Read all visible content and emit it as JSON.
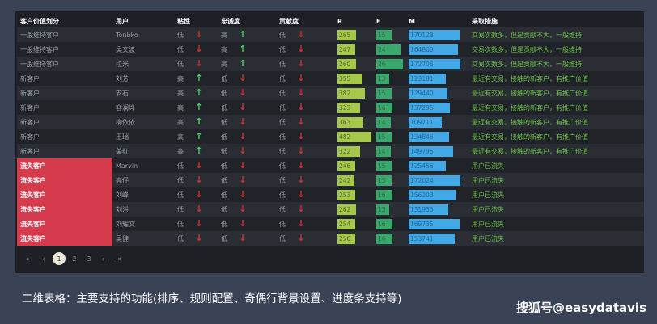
{
  "table": {
    "columns": [
      "客户价值划分",
      "用户",
      "粘性",
      "忠诚度",
      "贡献度",
      "R",
      "F",
      "M",
      "采取措施"
    ],
    "rows": [
      {
        "segment": "一般维持客户",
        "user": "Tonbko",
        "stick": "低",
        "stick_dir": "down",
        "loyal": "高",
        "loyal_dir": "up",
        "contrib": "低",
        "contrib_dir": "down",
        "r": 265,
        "f": 15,
        "m": 170128,
        "action": "交易次数多，但是贡献不大，一般维持"
      },
      {
        "segment": "一般维持客户",
        "user": "吴文波",
        "stick": "低",
        "stick_dir": "down",
        "loyal": "高",
        "loyal_dir": "up",
        "contrib": "低",
        "contrib_dir": "down",
        "r": 247,
        "f": 24,
        "m": 164800,
        "action": "交易次数多，但是贡献不大，一般维持"
      },
      {
        "segment": "一般维持客户",
        "user": "拉米",
        "stick": "低",
        "stick_dir": "down",
        "loyal": "高",
        "loyal_dir": "up",
        "contrib": "低",
        "contrib_dir": "down",
        "r": 260,
        "f": 26,
        "m": 172706,
        "action": "交易次数多，但是贡献不大，一般维持"
      },
      {
        "segment": "新客户",
        "user": "刘芳",
        "stick": "高",
        "stick_dir": "up",
        "loyal": "低",
        "loyal_dir": "down",
        "contrib": "低",
        "contrib_dir": "down",
        "r": 355,
        "f": 13,
        "m": 123181,
        "action": "最近有交易，接触的新客户，有推广价值"
      },
      {
        "segment": "新客户",
        "user": "安石",
        "stick": "高",
        "stick_dir": "up",
        "loyal": "低",
        "loyal_dir": "down",
        "contrib": "低",
        "contrib_dir": "down",
        "r": 382,
        "f": 15,
        "m": 129440,
        "action": "最近有交易，接触的新客户，有推广价值"
      },
      {
        "segment": "新客户",
        "user": "容澜烨",
        "stick": "高",
        "stick_dir": "up",
        "loyal": "低",
        "loyal_dir": "down",
        "contrib": "低",
        "contrib_dir": "down",
        "r": 323,
        "f": 16,
        "m": 137295,
        "action": "最近有交易，接触的新客户，有推广价值"
      },
      {
        "segment": "新客户",
        "user": "柳依依",
        "stick": "高",
        "stick_dir": "up",
        "loyal": "低",
        "loyal_dir": "down",
        "contrib": "低",
        "contrib_dir": "down",
        "r": 363,
        "f": 14,
        "m": 109711,
        "action": "最近有交易，接触的新客户，有推广价值"
      },
      {
        "segment": "新客户",
        "user": "王瑞",
        "stick": "高",
        "stick_dir": "up",
        "loyal": "低",
        "loyal_dir": "down",
        "contrib": "低",
        "contrib_dir": "down",
        "r": 482,
        "f": 15,
        "m": 134846,
        "action": "最近有交易，接触的新客户，有推广价值"
      },
      {
        "segment": "新客户",
        "user": "美红",
        "stick": "高",
        "stick_dir": "up",
        "loyal": "低",
        "loyal_dir": "down",
        "contrib": "低",
        "contrib_dir": "down",
        "r": 322,
        "f": 14,
        "m": 149795,
        "action": "最近有交易，接触的新客户，有推广价值"
      },
      {
        "segment": "流失客户",
        "user": "Marvin",
        "stick": "低",
        "stick_dir": "down",
        "loyal": "低",
        "loyal_dir": "down",
        "contrib": "低",
        "contrib_dir": "down",
        "r": 246,
        "f": 15,
        "m": 125456,
        "action": "用户已流失"
      },
      {
        "segment": "流失客户",
        "user": "亮仔",
        "stick": "低",
        "stick_dir": "down",
        "loyal": "低",
        "loyal_dir": "down",
        "contrib": "低",
        "contrib_dir": "down",
        "r": 242,
        "f": 15,
        "m": 172024,
        "action": "用户已流失"
      },
      {
        "segment": "流失客户",
        "user": "刘峰",
        "stick": "低",
        "stick_dir": "down",
        "loyal": "低",
        "loyal_dir": "down",
        "contrib": "低",
        "contrib_dir": "down",
        "r": 253,
        "f": 16,
        "m": 156203,
        "action": "用户已流失"
      },
      {
        "segment": "流失客户",
        "user": "刘洪",
        "stick": "低",
        "stick_dir": "down",
        "loyal": "低",
        "loyal_dir": "down",
        "contrib": "低",
        "contrib_dir": "down",
        "r": 262,
        "f": 13,
        "m": 131953,
        "action": "用户已流失"
      },
      {
        "segment": "流失客户",
        "user": "刘耀文",
        "stick": "低",
        "stick_dir": "down",
        "loyal": "低",
        "loyal_dir": "down",
        "contrib": "低",
        "contrib_dir": "down",
        "r": 254,
        "f": 16,
        "m": 169735,
        "action": "用户已流失"
      },
      {
        "segment": "流失客户",
        "user": "吴健",
        "stick": "低",
        "stick_dir": "down",
        "loyal": "低",
        "loyal_dir": "down",
        "contrib": "低",
        "contrib_dir": "down",
        "r": 250,
        "f": 16,
        "m": 153741,
        "action": "用户已流失"
      }
    ],
    "r_max": 500,
    "f_max": 30,
    "m_max": 200000
  },
  "pager": {
    "first": "⇤",
    "prev": "‹",
    "pages": [
      "1",
      "2",
      "3"
    ],
    "current": "1",
    "next": "›",
    "last": "⇥"
  },
  "caption": "二维表格：主要支持的功能(排序、规则配置、奇偶行背景设置、进度条支持等)",
  "brand": "搜狐号@easydatavis",
  "colors": {
    "lost_segment": "#d53b4c",
    "arrow_up": "#4cd964",
    "arrow_down": "#e0302a",
    "bar_r": "#a5c84a",
    "bar_f": "#3aa86c",
    "bar_m": "#42a8e6"
  }
}
